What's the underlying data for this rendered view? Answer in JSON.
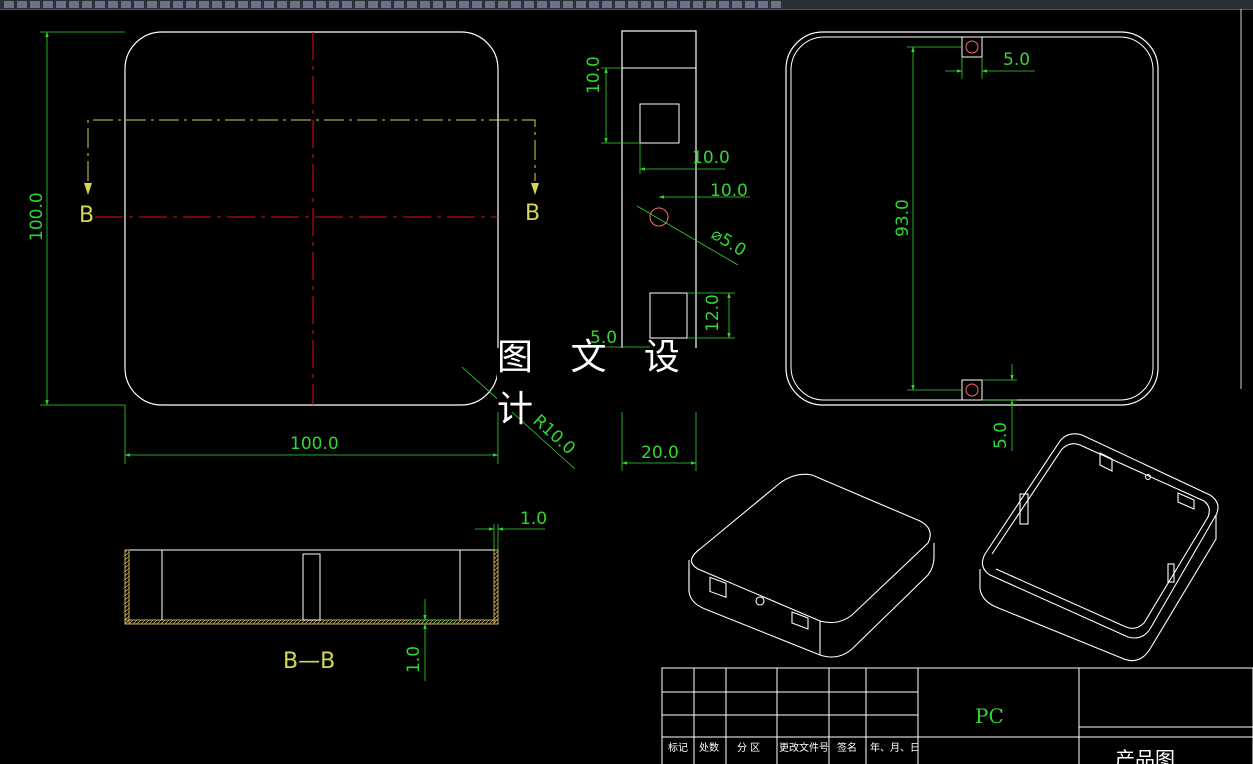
{
  "watermark": "图 文 设 计",
  "dimensions": {
    "top_width": "100.0",
    "top_height": "100.0",
    "radius": "R10.0",
    "side_10_a": "10.0",
    "side_10_b": "10.0",
    "side_10_c": "10.0",
    "side_diameter": "⌀5.0",
    "side_12": "12.0",
    "side_5": "5.0",
    "side_20": "20.0",
    "right_5_top": "5.0",
    "right_93": "93.0",
    "right_5_bottom": "5.0",
    "section_wall": "1.0",
    "section_floor": "1.0"
  },
  "section_marks": {
    "left": "B",
    "right": "B",
    "title": "B—B"
  },
  "title_block": {
    "col_headers": [
      "标记",
      "处数",
      "分 区",
      "更改文件号",
      "签名",
      "年、月、日"
    ],
    "material": "PC",
    "drawing_name": "产品图"
  },
  "colors": {
    "outline": "#ffffff",
    "dimension": "#2fd82f",
    "centerline": "#e01010",
    "section": "#d6d650",
    "hatch": "#c8b060"
  }
}
